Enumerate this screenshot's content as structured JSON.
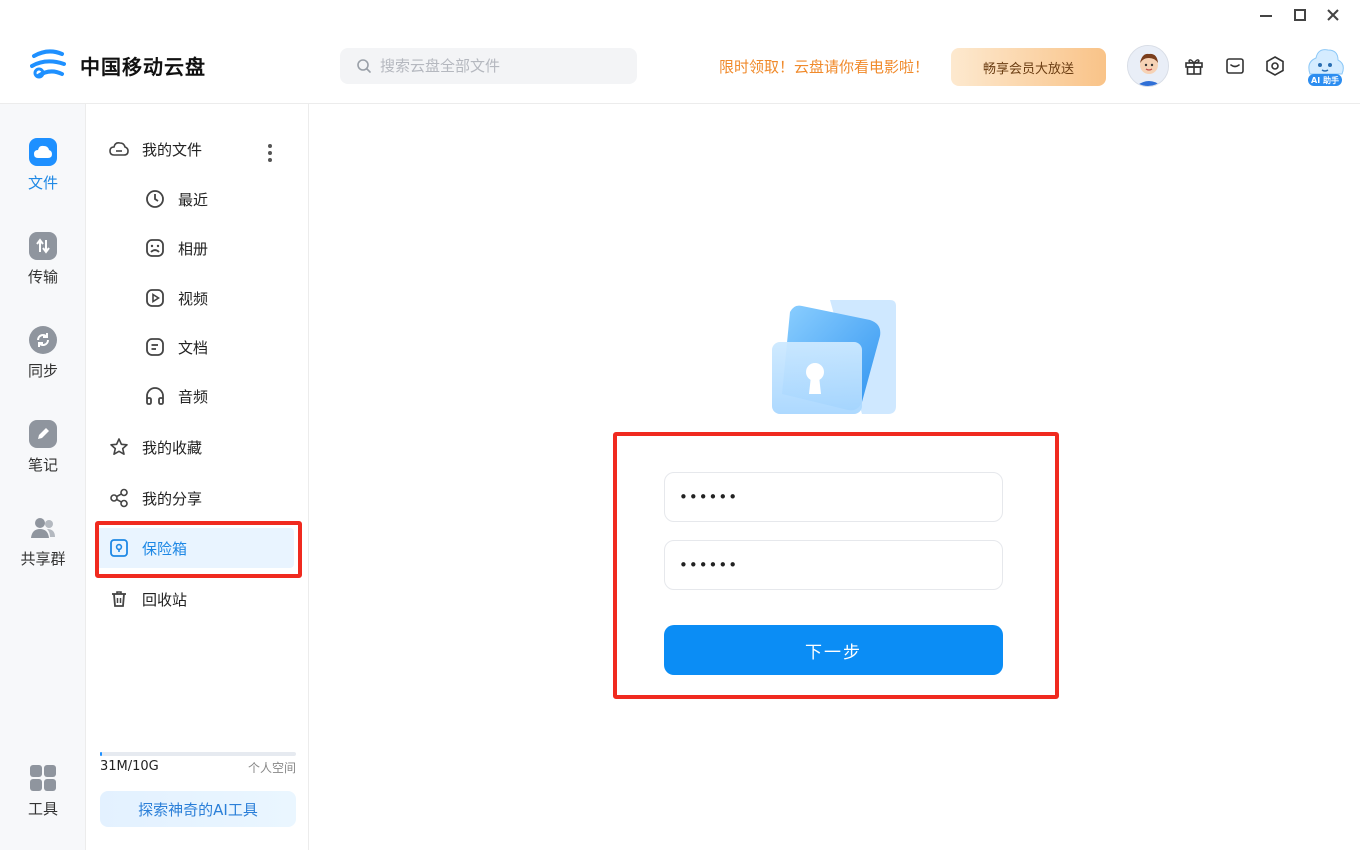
{
  "app": {
    "name": "中国移动云盘"
  },
  "header": {
    "search_placeholder": "搜索云盘全部文件",
    "promo_text": "限时领取！云盘请你看电影啦！",
    "vip_button": "畅享会员大放送",
    "ai_helper_label": "AI 助手",
    "icons": [
      "gift-icon",
      "mail-icon",
      "settings-icon"
    ]
  },
  "rail": {
    "items": [
      {
        "label": "文件",
        "icon": "cloud-icon",
        "active": true
      },
      {
        "label": "传输",
        "icon": "transfer-icon",
        "active": false
      },
      {
        "label": "同步",
        "icon": "sync-icon",
        "active": false
      },
      {
        "label": "笔记",
        "icon": "pen-icon",
        "active": false
      },
      {
        "label": "共享群",
        "icon": "group-icon",
        "active": false
      },
      {
        "label": "工具",
        "icon": "tools-icon",
        "active": false
      }
    ]
  },
  "nav": {
    "my_files": "我的文件",
    "recent": "最近",
    "album": "相册",
    "video": "视频",
    "docs": "文档",
    "audio": "音频",
    "favorites": "我的收藏",
    "shares": "我的分享",
    "safe_box": "保险箱",
    "recycle": "回收站",
    "active_item": "保险箱"
  },
  "storage": {
    "used": "31M/10G",
    "label": "个人空间",
    "fraction": 0.003
  },
  "ai_tools_button": "探索神奇的AI工具",
  "vault_form": {
    "password_value": "••••••",
    "confirm_value": "••••••",
    "next_button": "下一步"
  },
  "colors": {
    "accent": "#0b8df5",
    "promo": "#f08a2b",
    "highlight": "#f02a1f"
  }
}
